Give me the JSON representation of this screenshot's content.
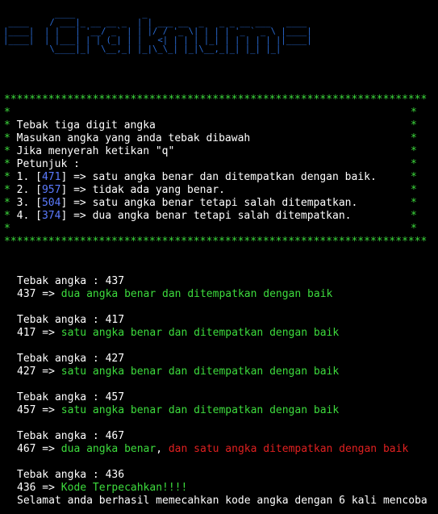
{
  "banner_lines": [
    "          ____             _",
    " ____    / ___|_ __ __ _  | | ___ __  _   _ _ __ ___   ____",
    "|____|  | |   | '__/ _` | | |/ / '_ \\| | | | '_ ` _ \\ |____|",
    "|____|  | |___| | | (_| | |   <| | | | |_| | | | | | ||____|",
    "         \\____|_|  \\__,_| |_|\\_\\_| |_|\\__,_|_| |_| |_|"
  ],
  "box": {
    "border": "*******************************************************************",
    "edge": "*",
    "lines": [
      "",
      "Tebak tiga digit angka",
      "Masukan angka yang anda tebak dibawah",
      "Jika menyerah ketikan \"q\"",
      "Petunjuk :",
      "",
      "",
      "",
      "",
      ""
    ],
    "hints": [
      {
        "prefix": "1. [",
        "code": "471",
        "suffix": "] => satu angka benar dan ditempatkan dengan baik."
      },
      {
        "prefix": "2. [",
        "code": "957",
        "suffix": "] => tidak ada yang benar."
      },
      {
        "prefix": "3. [",
        "code": "504",
        "suffix": "] => satu angka benar tetapi salah ditempatkan."
      },
      {
        "prefix": "4. [",
        "code": "374",
        "suffix": "] => dua angka benar tetapi salah ditempatkan."
      }
    ]
  },
  "guesses": [
    {
      "prompt": "Tebak angka : 437",
      "num": "437 => ",
      "green": "dua angka benar dan ditempatkan dengan baik",
      "red": ""
    },
    {
      "prompt": "Tebak angka : 417",
      "num": "417 => ",
      "green": "satu angka benar dan ditempatkan dengan baik",
      "red": ""
    },
    {
      "prompt": "Tebak angka : 427",
      "num": "427 => ",
      "green": "satu angka benar dan ditempatkan dengan baik",
      "red": ""
    },
    {
      "prompt": "Tebak angka : 457",
      "num": "457 => ",
      "green": "satu angka benar dan ditempatkan dengan baik",
      "red": ""
    },
    {
      "prompt": "Tebak angka : 467",
      "num": "467 => ",
      "green": "dua angka benar",
      "comma": ",",
      "red": " dan satu angka ditempatkan dengan baik"
    },
    {
      "prompt": "Tebak angka : 436",
      "num": "436 => ",
      "green": "Kode Terpecahkan!!!!",
      "red": ""
    }
  ],
  "final_message": "Selamat anda berhasil memecahkan kode angka dengan 6 kali mencoba",
  "colors": {
    "green": "#3ddc3d",
    "red": "#e02020",
    "blue": "#5b7bff",
    "banner": "#2a6bd4"
  }
}
